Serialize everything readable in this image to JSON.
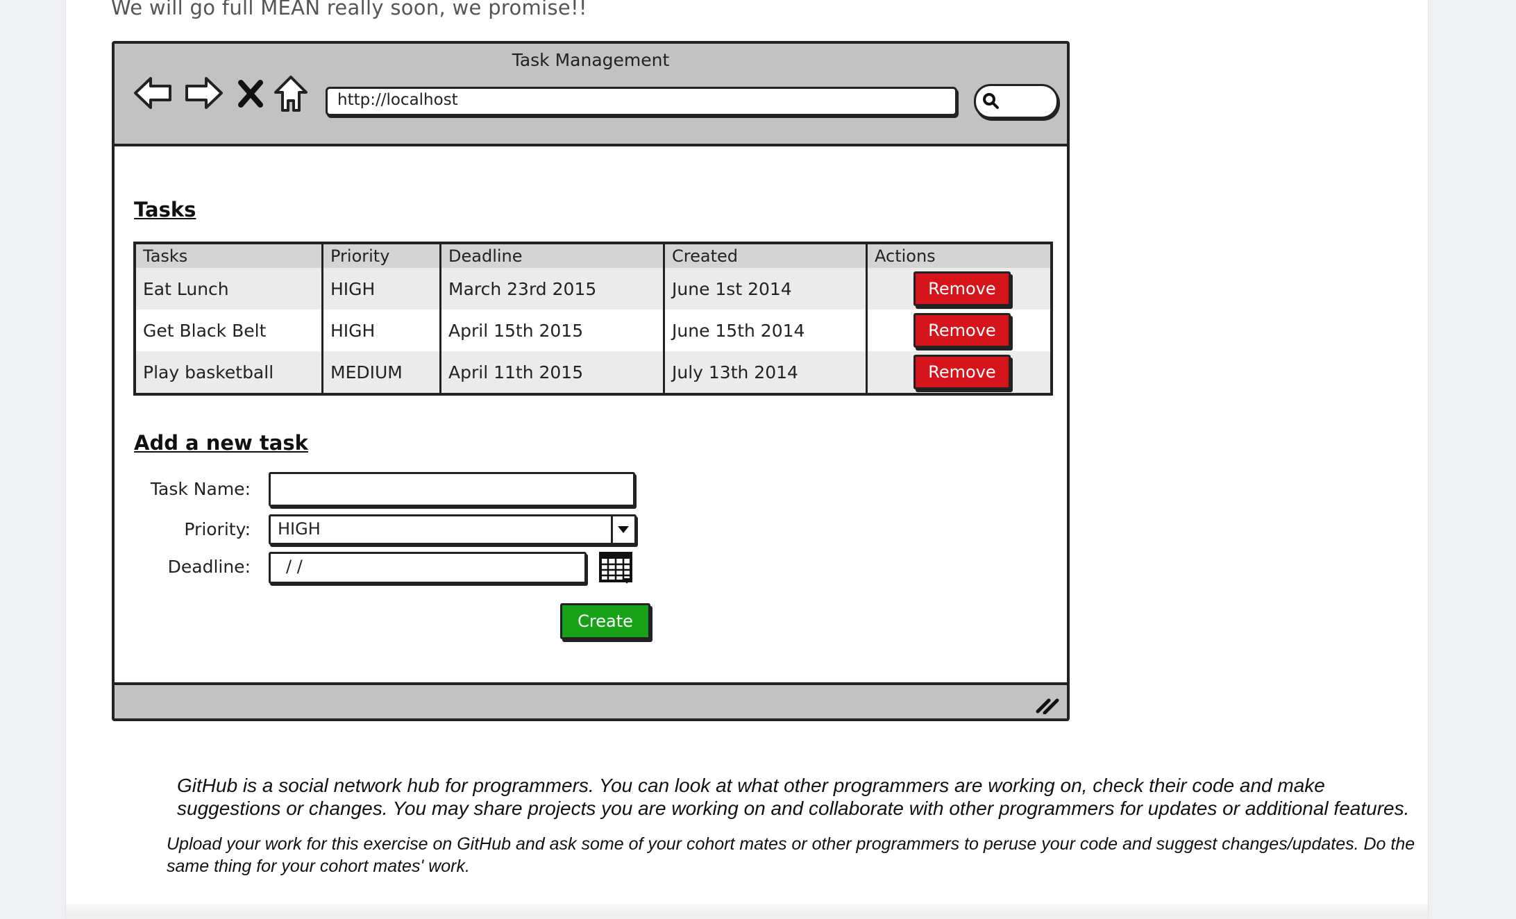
{
  "intro_text": "We will go full MEAN really soon, we promise!!",
  "mockup": {
    "window_title": "Task Management",
    "url": "http://localhost",
    "tasks_heading": "Tasks",
    "table": {
      "headers": [
        "Tasks",
        "Priority",
        "Deadline",
        "Created",
        "Actions"
      ],
      "rows": [
        {
          "task": "Eat Lunch",
          "priority": "HIGH",
          "deadline": "March 23rd 2015",
          "created": "June 1st 2014",
          "action": "Remove"
        },
        {
          "task": "Get Black Belt",
          "priority": "HIGH",
          "deadline": "April 15th 2015",
          "created": "June 15th 2014",
          "action": "Remove"
        },
        {
          "task": "Play basketball",
          "priority": "MEDIUM",
          "deadline": "April 11th 2015",
          "created": "July 13th 2014",
          "action": "Remove"
        }
      ]
    },
    "form": {
      "heading": "Add a new task",
      "task_name_label": "Task Name:",
      "task_name_value": "",
      "priority_label": "Priority:",
      "priority_value": "HIGH",
      "deadline_label": "Deadline:",
      "deadline_value": "/ /",
      "create_label": "Create"
    }
  },
  "paragraph_1": "GitHub is a social network hub for programmers. You can look at what other programmers are working on, check their code and make suggestions or changes. You may share projects you are working on and collaborate with other programmers for updates or additional features.",
  "paragraph_2": "Upload your work for this exercise on GitHub and ask some of your cohort mates or other programmers to peruse your code and suggest changes/updates. Do the same thing for your cohort mates' work.",
  "colors": {
    "remove_button": "#d6141c",
    "create_button": "#1aa11a",
    "chrome_gray": "#c2c2c2"
  }
}
